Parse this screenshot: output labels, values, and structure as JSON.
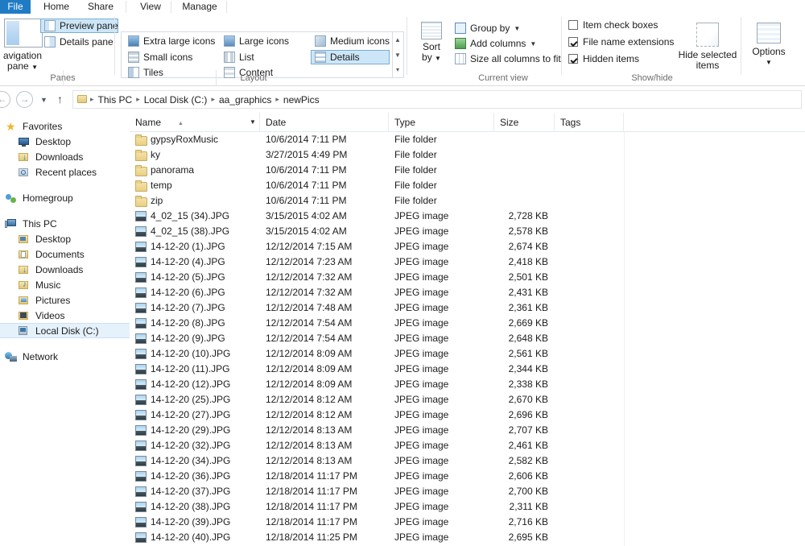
{
  "window": {
    "tabs": [
      {
        "id": "file",
        "label": "File"
      },
      {
        "id": "home",
        "label": "Home"
      },
      {
        "id": "share",
        "label": "Share"
      },
      {
        "id": "view",
        "label": "View"
      },
      {
        "id": "manage",
        "label": "Manage"
      }
    ],
    "active_tab": "View",
    "accent_color": "#1f7cc4",
    "selection_color": "#cde6f7"
  },
  "ribbon": {
    "groups": [
      {
        "id": "panes",
        "label": "Panes"
      },
      {
        "id": "layout",
        "label": "Layout"
      },
      {
        "id": "current_view",
        "label": "Current view"
      },
      {
        "id": "show_hide",
        "label": "Show/hide"
      }
    ],
    "panes": {
      "navigation_pane": "Navigation\npane",
      "navigation_pane_line1": "avigation",
      "navigation_pane_line2": "pane",
      "preview_pane": "Preview pane",
      "details_pane": "Details pane"
    },
    "layout": {
      "extra_large_icons": "Extra large icons",
      "large_icons": "Large icons",
      "medium_icons": "Medium icons",
      "small_icons": "Small icons",
      "list": "List",
      "details": "Details",
      "tiles": "Tiles",
      "content": "Content",
      "selected": "Details"
    },
    "current_view": {
      "sort_by_line1": "Sort",
      "sort_by_line2": "by",
      "group_by": "Group by",
      "add_columns": "Add columns",
      "size_all_columns_to_fit": "Size all columns to fit"
    },
    "show_hide": {
      "item_check_boxes": {
        "label": "Item check boxes",
        "checked": false
      },
      "file_name_extensions": {
        "label": "File name extensions",
        "checked": true
      },
      "hidden_items": {
        "label": "Hidden items",
        "checked": true
      },
      "hide_selected_items_line1": "Hide selected",
      "hide_selected_items_line2": "items"
    },
    "options": {
      "label": "Options"
    }
  },
  "address": {
    "back": "←",
    "forward": "→",
    "recent_locations": "▼",
    "up": "↑",
    "breadcrumbs": [
      "This PC",
      "Local Disk (C:)",
      "aa_graphics",
      "newPics"
    ],
    "separator": "▸"
  },
  "nav_pane": {
    "sections": [
      {
        "id": "favorites",
        "root": {
          "label": "Favorites",
          "icon": "star-icon"
        },
        "children": [
          {
            "label": "Desktop",
            "icon": "monitor-icon"
          },
          {
            "label": "Downloads",
            "icon": "downloads-folder-icon"
          },
          {
            "label": "Recent places",
            "icon": "recent-places-icon"
          }
        ]
      },
      {
        "id": "homegroup",
        "root": {
          "label": "Homegroup",
          "icon": "homegroup-icon"
        },
        "children": []
      },
      {
        "id": "this-pc",
        "root": {
          "label": "This PC",
          "icon": "computer-icon"
        },
        "children": [
          {
            "label": "Desktop",
            "icon": "desktop-folder-icon"
          },
          {
            "label": "Documents",
            "icon": "documents-folder-icon"
          },
          {
            "label": "Downloads",
            "icon": "downloads-folder-icon"
          },
          {
            "label": "Music",
            "icon": "music-folder-icon"
          },
          {
            "label": "Pictures",
            "icon": "pictures-folder-icon"
          },
          {
            "label": "Videos",
            "icon": "videos-folder-icon"
          },
          {
            "label": "Local Disk (C:)",
            "icon": "drive-icon",
            "selected": true
          }
        ]
      },
      {
        "id": "network",
        "root": {
          "label": "Network",
          "icon": "network-icon"
        },
        "children": []
      }
    ]
  },
  "file_list": {
    "columns": [
      {
        "id": "name",
        "label": "Name",
        "sorted": "asc"
      },
      {
        "id": "date",
        "label": "Date"
      },
      {
        "id": "type",
        "label": "Type"
      },
      {
        "id": "size",
        "label": "Size"
      },
      {
        "id": "tags",
        "label": "Tags"
      }
    ],
    "rows": [
      {
        "name": "gypsyRoxMusic",
        "date": "10/6/2014 7:11 PM",
        "type": "File folder",
        "size": "",
        "tags": "",
        "icon": "folder"
      },
      {
        "name": "ky",
        "date": "3/27/2015 4:49 PM",
        "type": "File folder",
        "size": "",
        "tags": "",
        "icon": "folder"
      },
      {
        "name": "panorama",
        "date": "10/6/2014 7:11 PM",
        "type": "File folder",
        "size": "",
        "tags": "",
        "icon": "folder"
      },
      {
        "name": "temp",
        "date": "10/6/2014 7:11 PM",
        "type": "File folder",
        "size": "",
        "tags": "",
        "icon": "folder"
      },
      {
        "name": "zip",
        "date": "10/6/2014 7:11 PM",
        "type": "File folder",
        "size": "",
        "tags": "",
        "icon": "folder"
      },
      {
        "name": "4_02_15 (34).JPG",
        "date": "3/15/2015 4:02 AM",
        "type": "JPEG image",
        "size": "2,728 KB",
        "tags": "",
        "icon": "jpg"
      },
      {
        "name": "4_02_15 (38).JPG",
        "date": "3/15/2015 4:02 AM",
        "type": "JPEG image",
        "size": "2,578 KB",
        "tags": "",
        "icon": "jpg"
      },
      {
        "name": "14-12-20 (1).JPG",
        "date": "12/12/2014 7:15 AM",
        "type": "JPEG image",
        "size": "2,674 KB",
        "tags": "",
        "icon": "jpg"
      },
      {
        "name": "14-12-20 (4).JPG",
        "date": "12/12/2014 7:23 AM",
        "type": "JPEG image",
        "size": "2,418 KB",
        "tags": "",
        "icon": "jpg"
      },
      {
        "name": "14-12-20 (5).JPG",
        "date": "12/12/2014 7:32 AM",
        "type": "JPEG image",
        "size": "2,501 KB",
        "tags": "",
        "icon": "jpg"
      },
      {
        "name": "14-12-20 (6).JPG",
        "date": "12/12/2014 7:32 AM",
        "type": "JPEG image",
        "size": "2,431 KB",
        "tags": "",
        "icon": "jpg"
      },
      {
        "name": "14-12-20 (7).JPG",
        "date": "12/12/2014 7:48 AM",
        "type": "JPEG image",
        "size": "2,361 KB",
        "tags": "",
        "icon": "jpg"
      },
      {
        "name": "14-12-20 (8).JPG",
        "date": "12/12/2014 7:54 AM",
        "type": "JPEG image",
        "size": "2,669 KB",
        "tags": "",
        "icon": "jpg"
      },
      {
        "name": "14-12-20 (9).JPG",
        "date": "12/12/2014 7:54 AM",
        "type": "JPEG image",
        "size": "2,648 KB",
        "tags": "",
        "icon": "jpg"
      },
      {
        "name": "14-12-20 (10).JPG",
        "date": "12/12/2014 8:09 AM",
        "type": "JPEG image",
        "size": "2,561 KB",
        "tags": "",
        "icon": "jpg"
      },
      {
        "name": "14-12-20 (11).JPG",
        "date": "12/12/2014 8:09 AM",
        "type": "JPEG image",
        "size": "2,344 KB",
        "tags": "",
        "icon": "jpg"
      },
      {
        "name": "14-12-20 (12).JPG",
        "date": "12/12/2014 8:09 AM",
        "type": "JPEG image",
        "size": "2,338 KB",
        "tags": "",
        "icon": "jpg"
      },
      {
        "name": "14-12-20 (25).JPG",
        "date": "12/12/2014 8:12 AM",
        "type": "JPEG image",
        "size": "2,670 KB",
        "tags": "",
        "icon": "jpg"
      },
      {
        "name": "14-12-20 (27).JPG",
        "date": "12/12/2014 8:12 AM",
        "type": "JPEG image",
        "size": "2,696 KB",
        "tags": "",
        "icon": "jpg"
      },
      {
        "name": "14-12-20 (29).JPG",
        "date": "12/12/2014 8:13 AM",
        "type": "JPEG image",
        "size": "2,707 KB",
        "tags": "",
        "icon": "jpg"
      },
      {
        "name": "14-12-20 (32).JPG",
        "date": "12/12/2014 8:13 AM",
        "type": "JPEG image",
        "size": "2,461 KB",
        "tags": "",
        "icon": "jpg"
      },
      {
        "name": "14-12-20 (34).JPG",
        "date": "12/12/2014 8:13 AM",
        "type": "JPEG image",
        "size": "2,582 KB",
        "tags": "",
        "icon": "jpg"
      },
      {
        "name": "14-12-20 (36).JPG",
        "date": "12/18/2014 11:17 PM",
        "type": "JPEG image",
        "size": "2,606 KB",
        "tags": "",
        "icon": "jpg"
      },
      {
        "name": "14-12-20 (37).JPG",
        "date": "12/18/2014 11:17 PM",
        "type": "JPEG image",
        "size": "2,700 KB",
        "tags": "",
        "icon": "jpg"
      },
      {
        "name": "14-12-20 (38).JPG",
        "date": "12/18/2014 11:17 PM",
        "type": "JPEG image",
        "size": "2,311 KB",
        "tags": "",
        "icon": "jpg"
      },
      {
        "name": "14-12-20 (39).JPG",
        "date": "12/18/2014 11:17 PM",
        "type": "JPEG image",
        "size": "2,716 KB",
        "tags": "",
        "icon": "jpg"
      },
      {
        "name": "14-12-20 (40).JPG",
        "date": "12/18/2014 11:25 PM",
        "type": "JPEG image",
        "size": "2,695 KB",
        "tags": "",
        "icon": "jpg"
      }
    ]
  }
}
